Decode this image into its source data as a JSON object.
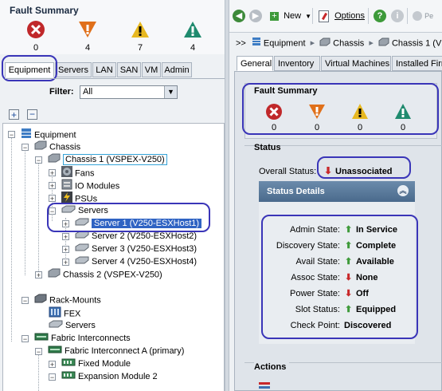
{
  "left": {
    "fault_summary": {
      "title": "Fault Summary",
      "counts": [
        {
          "severity": "critical",
          "icon": "critical-x-icon",
          "color": "#c0282a",
          "count": "0"
        },
        {
          "severity": "major",
          "icon": "major-down-triangle-icon",
          "color": "#e0701a",
          "count": "4"
        },
        {
          "severity": "minor",
          "icon": "minor-triangle-icon",
          "color": "#e7b820",
          "count": "7"
        },
        {
          "severity": "warning",
          "icon": "warning-triangle-icon",
          "color": "#1f8a6e",
          "count": "4"
        }
      ]
    },
    "tabs": [
      "Equipment",
      "Servers",
      "LAN",
      "SAN",
      "VM",
      "Admin"
    ],
    "filter": {
      "label": "Filter:",
      "value": "All"
    },
    "tree": [
      "Equipment",
      "Chassis",
      "Chassis 1 (VSPEX-V250)",
      "Fans",
      "IO Modules",
      "PSUs",
      "Servers",
      "Server 1 (V250-ESXHost1)",
      "Server 2 (V250-ESXHost2)",
      "Server 3 (V250-ESXHost3)",
      "Server 4 (V250-ESXHost4)",
      "Chassis 2 (VSPEX-V250)",
      "Rack-Mounts",
      "FEX",
      "Servers",
      "Fabric Interconnects",
      "Fabric Interconnect A (primary)",
      "Fixed Module",
      "Expansion Module 2"
    ]
  },
  "right": {
    "toolbar": {
      "new_label": "New",
      "options_label": "Options",
      "pending_label": "Pe"
    },
    "breadcrumb": {
      "prefix": ">>",
      "items": [
        "Equipment",
        "Chassis",
        "Chassis 1 (V"
      ]
    },
    "tabs": [
      "General",
      "Inventory",
      "Virtual Machines",
      "Installed Firm"
    ],
    "fault_summary": {
      "title": "Fault Summary",
      "counts": [
        "0",
        "0",
        "0",
        "0"
      ]
    },
    "status": {
      "title": "Status",
      "overall_label": "Overall Status:",
      "overall_value": "Unassociated",
      "details_title": "Status Details",
      "rows": [
        {
          "label": "Admin State:",
          "value": "In Service",
          "arrow": "up"
        },
        {
          "label": "Discovery State:",
          "value": "Complete",
          "arrow": "up"
        },
        {
          "label": "Avail State:",
          "value": "Available",
          "arrow": "up"
        },
        {
          "label": "Assoc State:",
          "value": "None",
          "arrow": "down"
        },
        {
          "label": "Power State:",
          "value": "Off",
          "arrow": "down"
        },
        {
          "label": "Slot Status:",
          "value": "Equipped",
          "arrow": "up"
        },
        {
          "label": "Check Point:",
          "value": "Discovered",
          "arrow": "none"
        }
      ]
    },
    "actions": {
      "title": "Actions"
    }
  },
  "colors": {
    "up_arrow": "#3e9a3a",
    "down_arrow": "#c8282a",
    "highlight_oval": "#3a35b8",
    "selection": "#2f63c3"
  }
}
